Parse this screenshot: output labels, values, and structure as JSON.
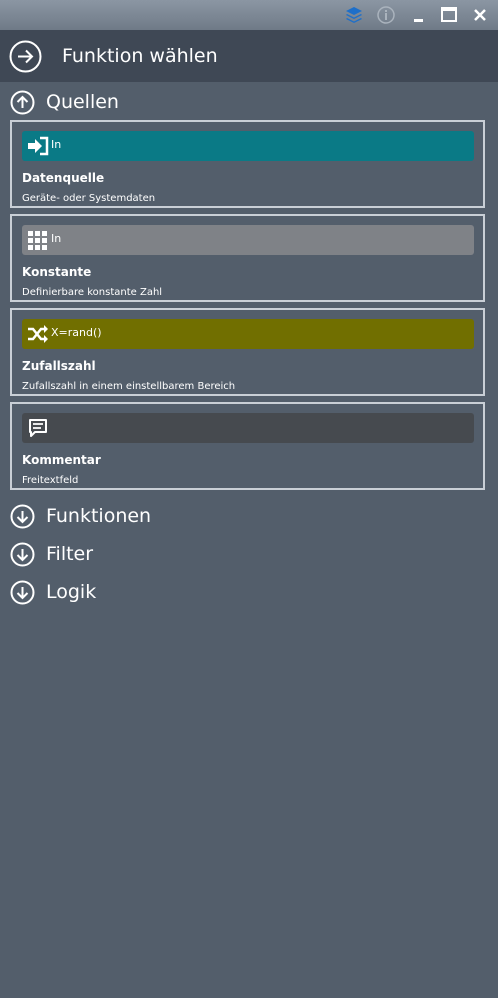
{
  "window": {
    "controls": [
      "layers-icon",
      "info-icon",
      "minimize-icon",
      "maximize-icon",
      "close-icon"
    ]
  },
  "header": {
    "title": "Funktion wählen",
    "icon": "arrow-right-circle-icon"
  },
  "sections": {
    "quellen": {
      "label": "Quellen",
      "state": "expanded",
      "icon": "arrow-up-circle-icon"
    },
    "funktionen": {
      "label": "Funktionen",
      "state": "collapsed",
      "icon": "arrow-down-circle-icon"
    },
    "filter": {
      "label": "Filter",
      "state": "collapsed",
      "icon": "arrow-down-circle-icon"
    },
    "logik": {
      "label": "Logik",
      "state": "collapsed",
      "icon": "arrow-down-circle-icon"
    }
  },
  "cards": [
    {
      "bar_text": "In",
      "bar_icon": "sign-in-icon",
      "bar_color": "#0a7a86",
      "name": "Datenquelle",
      "description": "Geräte- oder Systemdaten"
    },
    {
      "bar_text": "In",
      "bar_icon": "grid-icon",
      "bar_color": "#7f8287",
      "name": "Konstante",
      "description": "Definierbare konstante Zahl"
    },
    {
      "bar_text": "X=rand()",
      "bar_icon": "shuffle-icon",
      "bar_color": "#716f00",
      "name": "Zufallszahl",
      "description": "Zufallszahl in einem einstellbarem Bereich"
    },
    {
      "bar_text": "",
      "bar_icon": "comment-icon",
      "bar_color": "#464a4f",
      "name": "Kommentar",
      "description": "Freitextfeld"
    }
  ],
  "colors": {
    "background": "#535e6b",
    "header": "#3f4855",
    "card_border": "#c9cfd6",
    "accent_blue": "#1e6fc9"
  }
}
